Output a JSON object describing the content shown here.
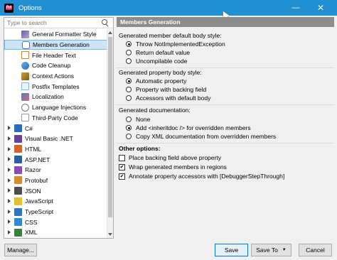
{
  "window": {
    "title": "Options",
    "app_icon_text": "R#",
    "minimize_glyph": "—",
    "close_glyph": "✕"
  },
  "search": {
    "placeholder": "Type to search"
  },
  "tree": {
    "items": [
      {
        "label": "General Formatter Style",
        "icon": "formatter-icon",
        "level": "sub"
      },
      {
        "label": "Members Generation",
        "icon": "members-icon",
        "level": "sub",
        "selected": true
      },
      {
        "label": "File Header Text",
        "icon": "file-header-icon",
        "level": "sub"
      },
      {
        "label": "Code Cleanup",
        "icon": "code-cleanup-icon",
        "level": "sub"
      },
      {
        "label": "Context Actions",
        "icon": "context-actions-icon",
        "level": "sub"
      },
      {
        "label": "Postfix Templates",
        "icon": "postfix-icon",
        "level": "sub"
      },
      {
        "label": "Localization",
        "icon": "localization-icon",
        "level": "sub"
      },
      {
        "label": "Language Injections",
        "icon": "language-injections-icon",
        "level": "sub"
      },
      {
        "label": "Third-Party Code",
        "icon": "third-party-icon",
        "level": "sub"
      },
      {
        "label": "C#",
        "icon": "csharp-icon",
        "level": "top"
      },
      {
        "label": "Visual Basic .NET",
        "icon": "vb-icon",
        "level": "top"
      },
      {
        "label": "HTML",
        "icon": "html-icon",
        "level": "top"
      },
      {
        "label": "ASP.NET",
        "icon": "aspnet-icon",
        "level": "top"
      },
      {
        "label": "Razor",
        "icon": "razor-icon",
        "level": "top"
      },
      {
        "label": "Protobuf",
        "icon": "protobuf-icon",
        "level": "top"
      },
      {
        "label": "JSON",
        "icon": "json-icon",
        "level": "top"
      },
      {
        "label": "JavaScript",
        "icon": "javascript-icon",
        "level": "top"
      },
      {
        "label": "TypeScript",
        "icon": "typescript-icon",
        "level": "top"
      },
      {
        "label": "CSS",
        "icon": "css-icon",
        "level": "top"
      },
      {
        "label": "XML",
        "icon": "xml-icon",
        "level": "top"
      }
    ]
  },
  "main": {
    "section_title": "Members Generation",
    "body_style": {
      "label": "Generated member default body style:",
      "options": [
        "Throw NotImplementedException",
        "Return default value",
        "Uncompilable code"
      ],
      "selected": 0
    },
    "property_style": {
      "label": "Generated property body style:",
      "options": [
        "Automatic property",
        "Property with backing field",
        "Accessors with default body"
      ],
      "selected": 0
    },
    "documentation": {
      "label": "Generated documentation:",
      "options": [
        "None",
        "Add <inheritdoc /> for overridden members",
        "Copy XML documentation from overridden members"
      ],
      "selected": 1
    },
    "other_options": {
      "label": "Other options:",
      "checkboxes": [
        {
          "label": "Place backing field above property",
          "checked": false
        },
        {
          "label": "Wrap generated members in regions",
          "checked": true
        },
        {
          "label": "Annotate property accessors with [DebuggerStepThrough]",
          "checked": true
        }
      ]
    }
  },
  "buttons": {
    "manage": "Manage...",
    "save": "Save",
    "save_to": "Save To",
    "cancel": "Cancel"
  }
}
